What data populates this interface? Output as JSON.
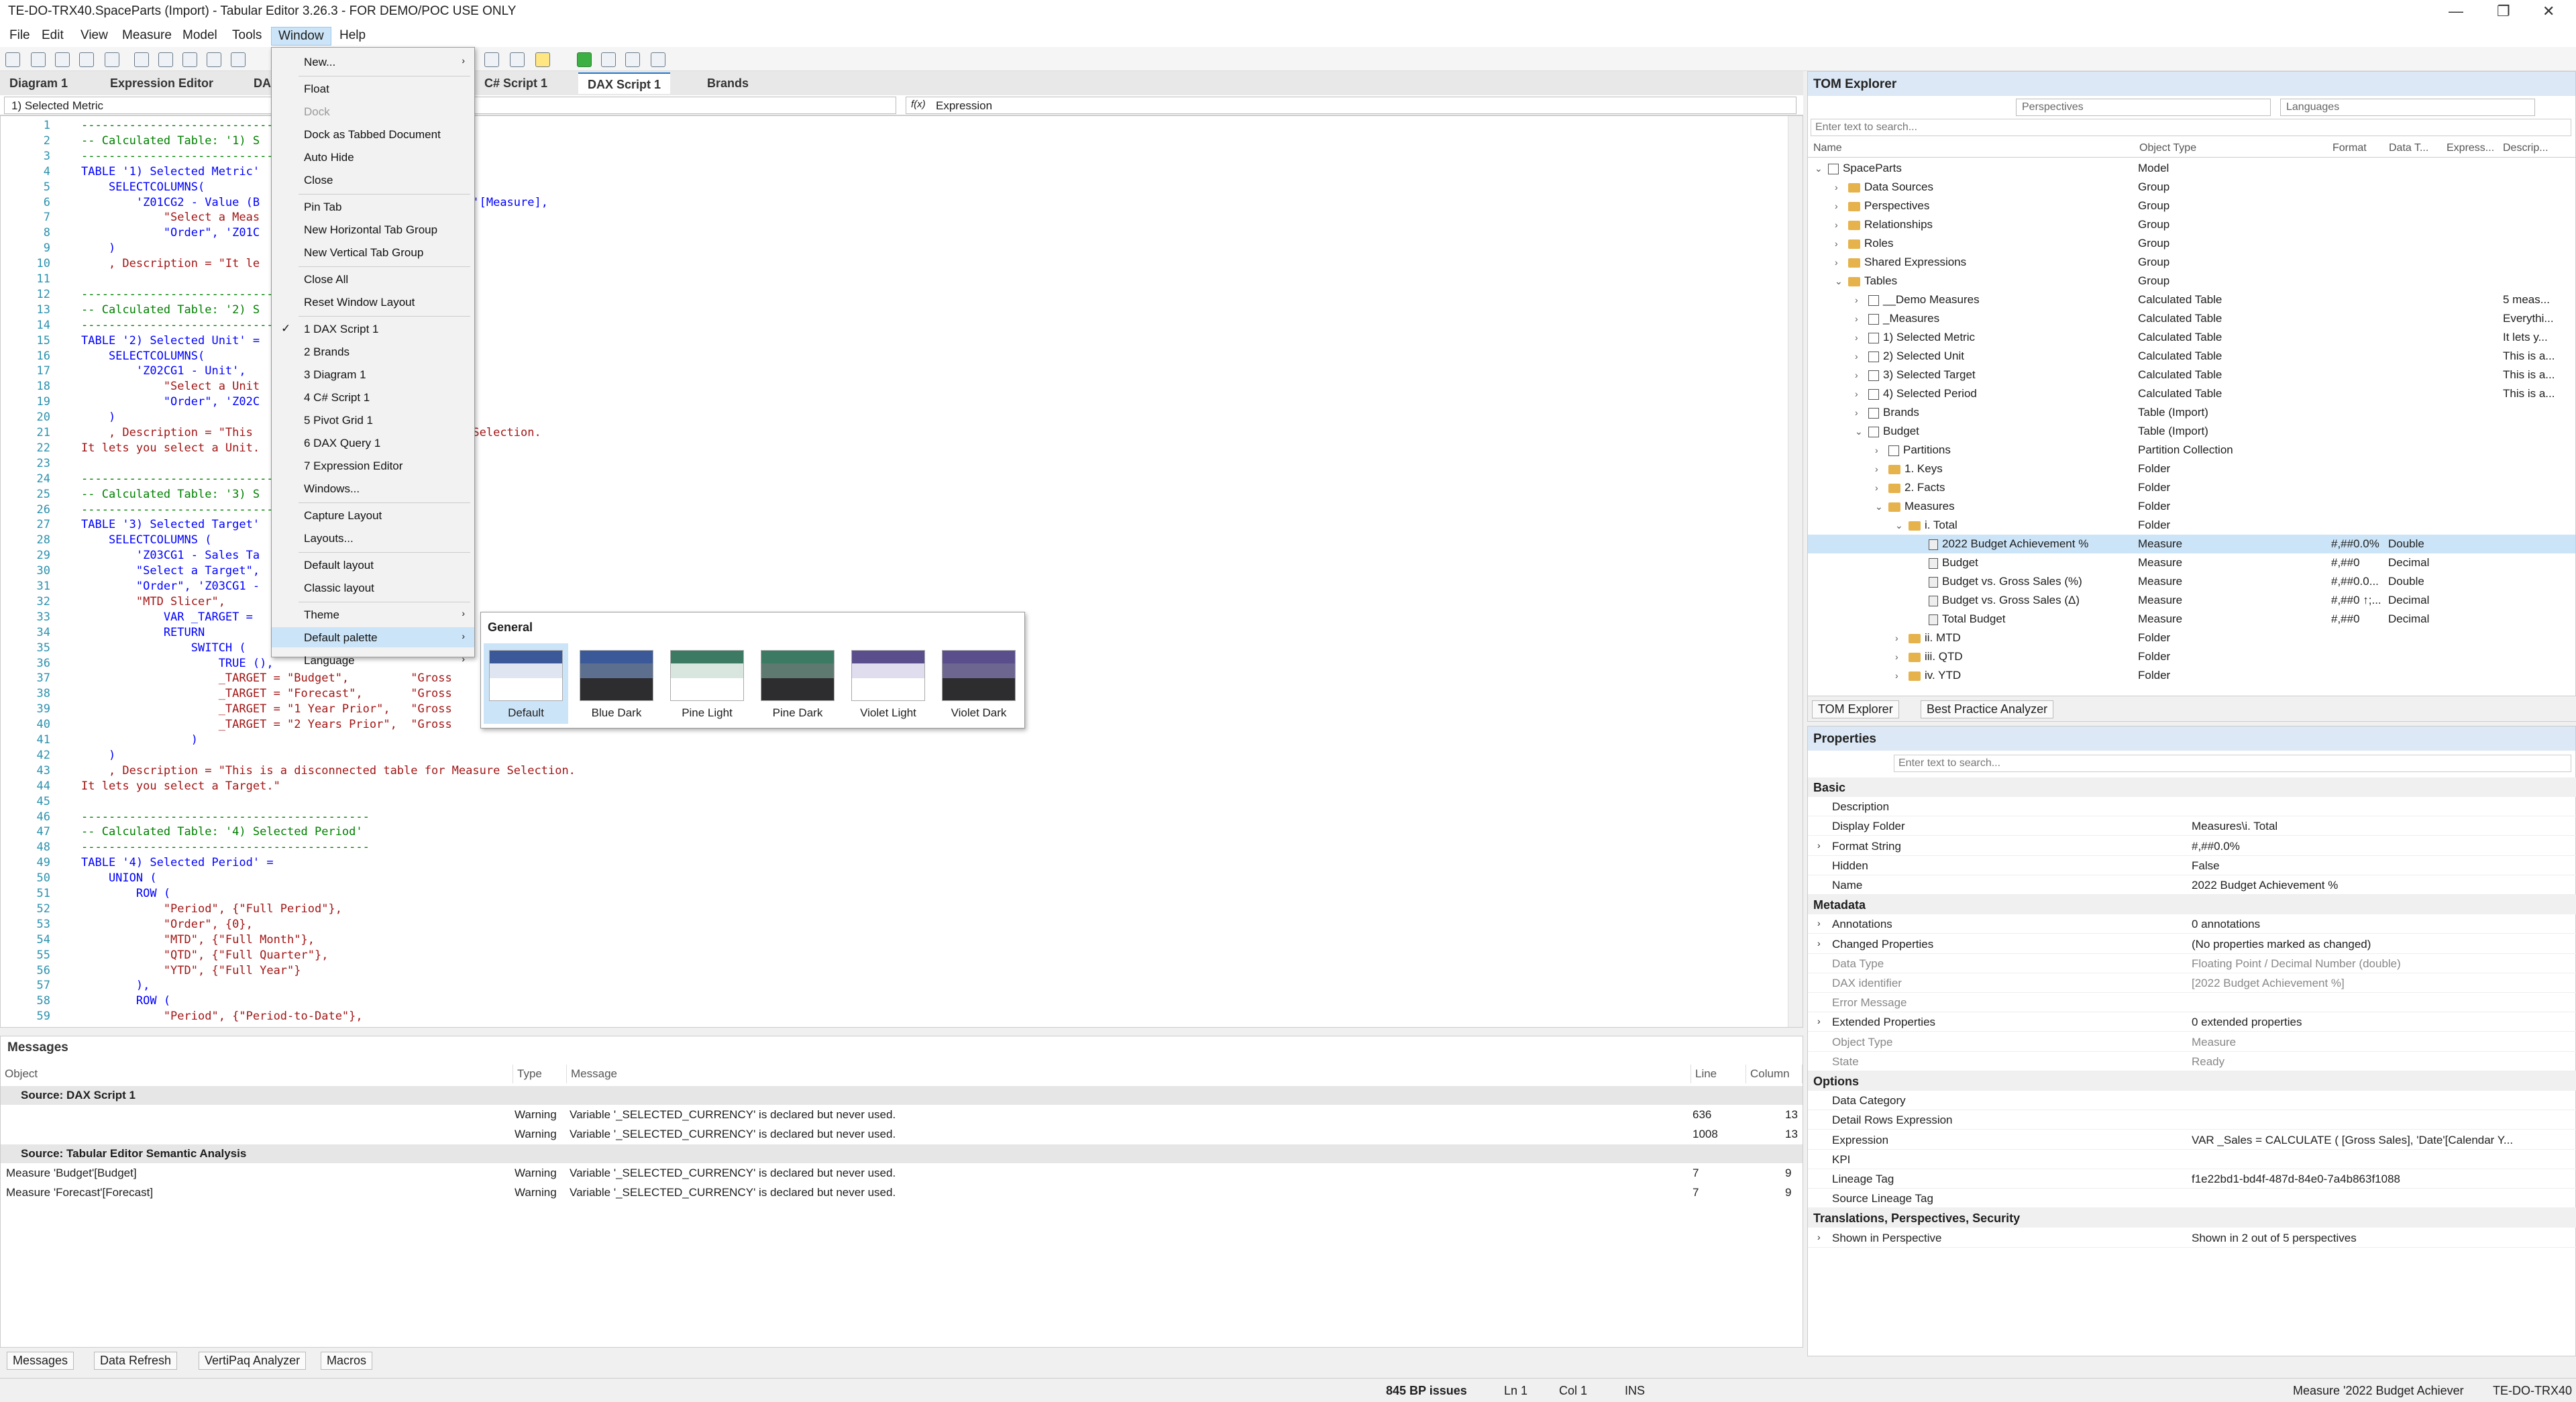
{
  "window": {
    "title": "TE-DO-TRX40.SpaceParts (Import) - Tabular Editor 3.26.3 - FOR DEMO/POC USE ONLY",
    "min": "—",
    "max": "❐",
    "close": "✕"
  },
  "menubar": [
    "File",
    "Edit",
    "View",
    "Measure",
    "Model",
    "Tools",
    "Window",
    "Help"
  ],
  "tabs": [
    "Diagram 1",
    "Expression Editor",
    "DA",
    "C# Script 1",
    "DAX Script 1",
    "Brands"
  ],
  "dropdowns": {
    "left": "1) Selected Metric",
    "right": "Expression",
    "fx": "f(x)"
  },
  "editor": {
    "lines": [
      "1",
      "2",
      "3",
      "4",
      "5",
      "6",
      "7",
      "8",
      "9",
      "10",
      "11",
      "12",
      "13",
      "14",
      "15",
      "16",
      "17",
      "18",
      "19",
      "20",
      "21",
      "22",
      "23",
      "24",
      "25",
      "26",
      "27",
      "28",
      "29",
      "30",
      "31",
      "32",
      "33",
      "34",
      "35",
      "36",
      "37",
      "38",
      "39",
      "40",
      "41",
      "42",
      "43",
      "44",
      "45",
      "46",
      "47",
      "48",
      "49",
      "50",
      "51",
      "52",
      "53",
      "54",
      "55",
      "56",
      "57",
      "58",
      "59"
    ],
    "code": [
      {
        "t": "------------------------------------------",
        "c": "c"
      },
      {
        "t": "-- Calculated Table: '1) S",
        "c": "c"
      },
      {
        "t": "------------------------------------------",
        "c": "c"
      },
      {
        "t": "TABLE '1) Selected Metric'",
        "c": "k"
      },
      {
        "t": "    SELECTCOLUMNS(",
        "c": "k"
      },
      {
        "t": "        'Z01CG2 - Value (B                        t Rate)'[Measure],",
        "c": "k"
      },
      {
        "t": "            \"Select a Meas",
        "c": "s"
      },
      {
        "t": "            \"Order\", 'Z01C                       rdinal]",
        "c": "k"
      },
      {
        "t": "    )",
        "c": "k"
      },
      {
        "t": "    , Description = \"It le",
        "c": "s"
      },
      {
        "t": "",
        "c": "k"
      },
      {
        "t": "------------------------------------------",
        "c": "c"
      },
      {
        "t": "-- Calculated Table: '2) S",
        "c": "c"
      },
      {
        "t": "------------------------------------------",
        "c": "c"
      },
      {
        "t": "TABLE '2) Selected Unit' =",
        "c": "k"
      },
      {
        "t": "    SELECTCOLUMNS(",
        "c": "k"
      },
      {
        "t": "        'Z02CG1 - Unit',",
        "c": "k"
      },
      {
        "t": "            \"Select a Unit",
        "c": "s"
      },
      {
        "t": "            \"Order\", 'Z02C",
        "c": "k"
      },
      {
        "t": "    )",
        "c": "k"
      },
      {
        "t": "    , Description = \"This                        Measure Selection.",
        "c": "s"
      },
      {
        "t": "It lets you select a Unit.",
        "c": "s"
      },
      {
        "t": "",
        "c": "k"
      },
      {
        "t": "------------------------------------------",
        "c": "c"
      },
      {
        "t": "-- Calculated Table: '3) S",
        "c": "c"
      },
      {
        "t": "------------------------------------------",
        "c": "c"
      },
      {
        "t": "TABLE '3) Selected Target'",
        "c": "k"
      },
      {
        "t": "    SELECTCOLUMNS (",
        "c": "k"
      },
      {
        "t": "        'Z03CG1 - Sales Ta",
        "c": "k"
      },
      {
        "t": "        \"Select a Target\",                        rget],",
        "c": "k"
      },
      {
        "t": "        \"Order\", 'Z03CG1 -",
        "c": "k"
      },
      {
        "t": "        \"MTD Slicer\",",
        "c": "s"
      },
      {
        "t": "            VAR _TARGET =",
        "c": "k"
      },
      {
        "t": "            RETURN",
        "c": "k"
      },
      {
        "t": "                SWITCH (",
        "c": "k"
      },
      {
        "t": "                    TRUE (),",
        "c": "k"
      },
      {
        "t": "                    _TARGET = \"Budget\",         \"Gross",
        "c": "s"
      },
      {
        "t": "                    _TARGET = \"Forecast\",       \"Gross",
        "c": "s"
      },
      {
        "t": "                    _TARGET = \"1 Year Prior\",   \"Gross",
        "c": "s"
      },
      {
        "t": "                    _TARGET = \"2 Years Prior\",  \"Gross",
        "c": "s"
      },
      {
        "t": "                )",
        "c": "k"
      },
      {
        "t": "    )",
        "c": "k"
      },
      {
        "t": "    , Description = \"This is a disconnected table for Measure Selection.",
        "c": "s"
      },
      {
        "t": "It lets you select a Target.\"",
        "c": "s"
      },
      {
        "t": "",
        "c": "k"
      },
      {
        "t": "------------------------------------------",
        "c": "c"
      },
      {
        "t": "-- Calculated Table: '4) Selected Period'",
        "c": "c"
      },
      {
        "t": "------------------------------------------",
        "c": "c"
      },
      {
        "t": "TABLE '4) Selected Period' =",
        "c": "k"
      },
      {
        "t": "    UNION (",
        "c": "k"
      },
      {
        "t": "        ROW (",
        "c": "k"
      },
      {
        "t": "            \"Period\", {\"Full Period\"},",
        "c": "s"
      },
      {
        "t": "            \"Order\", {0},",
        "c": "s"
      },
      {
        "t": "            \"MTD\", {\"Full Month\"},",
        "c": "s"
      },
      {
        "t": "            \"QTD\", {\"Full Quarter\"},",
        "c": "s"
      },
      {
        "t": "            \"YTD\", {\"Full Year\"}",
        "c": "s"
      },
      {
        "t": "        ),",
        "c": "k"
      },
      {
        "t": "        ROW (",
        "c": "k"
      },
      {
        "t": "            \"Period\", {\"Period-to-Date\"},",
        "c": "s"
      }
    ]
  },
  "window_menu": {
    "items": [
      {
        "label": "New...",
        "sub": "›"
      },
      {
        "label": "Float"
      },
      {
        "label": "Dock",
        "disabled": true
      },
      {
        "label": "Dock as Tabbed Document"
      },
      {
        "label": "Auto Hide"
      },
      {
        "label": "Close"
      },
      {
        "label": "Pin Tab"
      },
      {
        "label": "New Horizontal Tab Group"
      },
      {
        "label": "New Vertical Tab Group"
      },
      {
        "label": "Close All"
      },
      {
        "label": "Reset Window Layout"
      },
      {
        "label": "1 DAX Script 1",
        "check": "✓"
      },
      {
        "label": "2 Brands"
      },
      {
        "label": "3 Diagram 1"
      },
      {
        "label": "4 C# Script 1"
      },
      {
        "label": "5 Pivot Grid 1"
      },
      {
        "label": "6 DAX Query 1"
      },
      {
        "label": "7 Expression Editor"
      },
      {
        "label": "Windows..."
      },
      {
        "label": "Capture Layout"
      },
      {
        "label": "Layouts..."
      },
      {
        "label": "Default layout"
      },
      {
        "label": "Classic layout"
      },
      {
        "label": "Theme",
        "sub": "›"
      },
      {
        "label": "Default palette",
        "sub": "›"
      },
      {
        "label": "Language",
        "sub": "›"
      }
    ]
  },
  "palette": {
    "group": "General",
    "items": [
      {
        "name": "Default",
        "c1": "#3b5998",
        "c2": "#dfe6f2",
        "c3": "#ffffff"
      },
      {
        "name": "Blue Dark",
        "c1": "#3b5998",
        "c2": "#5d6f8e",
        "c3": "#2d2d30"
      },
      {
        "name": "Pine Light",
        "c1": "#3c7a64",
        "c2": "#d8e6df",
        "c3": "#ffffff"
      },
      {
        "name": "Pine Dark",
        "c1": "#3c7a64",
        "c2": "#5e7a70",
        "c3": "#2d2d30"
      },
      {
        "name": "Violet Light",
        "c1": "#5a4f8c",
        "c2": "#e0ddef",
        "c3": "#ffffff"
      },
      {
        "name": "Violet Dark",
        "c1": "#5a4f8c",
        "c2": "#6d6690",
        "c3": "#2d2d30"
      }
    ]
  },
  "messages": {
    "title": "Messages",
    "columns": [
      "Object",
      "Type",
      "Message",
      "Line",
      "Column"
    ],
    "rows": [
      {
        "group": "Source: DAX Script 1"
      },
      {
        "object": "",
        "type": "Warning",
        "message": "Variable '_SELECTED_CURRENCY' is declared but never used.",
        "line": "636",
        "col": "13"
      },
      {
        "object": "",
        "type": "Warning",
        "message": "Variable '_SELECTED_CURRENCY' is declared but never used.",
        "line": "1008",
        "col": "13"
      },
      {
        "group": "Source: Tabular Editor Semantic Analysis"
      },
      {
        "object": "Measure 'Budget'[Budget]",
        "type": "Warning",
        "message": "Variable '_SELECTED_CURRENCY' is declared but never used.",
        "line": "7",
        "col": "9"
      },
      {
        "object": "Measure 'Forecast'[Forecast]",
        "type": "Warning",
        "message": "Variable '_SELECTED_CURRENCY' is declared but never used.",
        "line": "7",
        "col": "9"
      }
    ]
  },
  "bottom_tabs": [
    "Messages",
    "Data Refresh",
    "VertiPaq Analyzer",
    "Macros"
  ],
  "status": {
    "bp": "845 BP issues",
    "ln": "Ln 1",
    "col": "Col 1",
    "ins": "INS",
    "obj": "Measure '2022 Budget Achiever",
    "server": "TE-DO-TRX40"
  },
  "tom": {
    "title": "TOM Explorer",
    "perspectives": "Perspectives",
    "languages": "Languages",
    "filter": "Enter text to search...",
    "columns": [
      "Name",
      "Object Type",
      "Format",
      "Data T...",
      "Express...",
      "Descrip..."
    ],
    "nodes": [
      {
        "d": 0,
        "a": "⌄",
        "i": "tbl",
        "n": "SpaceParts",
        "t": "Model"
      },
      {
        "d": 1,
        "a": "›",
        "i": "fld",
        "n": "Data Sources",
        "t": "Group"
      },
      {
        "d": 1,
        "a": "›",
        "i": "fld",
        "n": "Perspectives",
        "t": "Group"
      },
      {
        "d": 1,
        "a": "›",
        "i": "fld",
        "n": "Relationships",
        "t": "Group"
      },
      {
        "d": 1,
        "a": "›",
        "i": "fld",
        "n": "Roles",
        "t": "Group"
      },
      {
        "d": 1,
        "a": "›",
        "i": "fld",
        "n": "Shared Expressions",
        "t": "Group"
      },
      {
        "d": 1,
        "a": "⌄",
        "i": "fld",
        "n": "Tables",
        "t": "Group"
      },
      {
        "d": 2,
        "a": "›",
        "i": "tbl",
        "n": "__Demo Measures",
        "t": "Calculated Table",
        "de": "5 meas..."
      },
      {
        "d": 2,
        "a": "›",
        "i": "tbl",
        "n": "_Measures",
        "t": "Calculated Table",
        "de": "Everythi..."
      },
      {
        "d": 2,
        "a": "›",
        "i": "tbl",
        "n": "1) Selected Metric",
        "t": "Calculated Table",
        "de": "It lets y..."
      },
      {
        "d": 2,
        "a": "›",
        "i": "tbl",
        "n": "2) Selected Unit",
        "t": "Calculated Table",
        "de": "This is a..."
      },
      {
        "d": 2,
        "a": "›",
        "i": "tbl",
        "n": "3) Selected Target",
        "t": "Calculated Table",
        "de": "This is a..."
      },
      {
        "d": 2,
        "a": "›",
        "i": "tbl",
        "n": "4) Selected Period",
        "t": "Calculated Table",
        "de": "This is a..."
      },
      {
        "d": 2,
        "a": "›",
        "i": "tbl",
        "n": "Brands",
        "t": "Table (Import)"
      },
      {
        "d": 2,
        "a": "⌄",
        "i": "tbl",
        "n": "Budget",
        "t": "Table (Import)"
      },
      {
        "d": 3,
        "a": "›",
        "i": "tbl",
        "n": "Partitions",
        "t": "Partition Collection"
      },
      {
        "d": 3,
        "a": "›",
        "i": "fld",
        "n": "1. Keys",
        "t": "Folder"
      },
      {
        "d": 3,
        "a": "›",
        "i": "fld",
        "n": "2. Facts",
        "t": "Folder"
      },
      {
        "d": 3,
        "a": "⌄",
        "i": "fld",
        "n": "Measures",
        "t": "Folder"
      },
      {
        "d": 4,
        "a": "⌄",
        "i": "fld",
        "n": "i. Total",
        "t": "Folder"
      },
      {
        "d": 5,
        "a": "",
        "i": "msr",
        "n": "2022 Budget Achievement %",
        "t": "Measure",
        "f": "#,##0.0%",
        "dt": "Double",
        "sel": true
      },
      {
        "d": 5,
        "a": "",
        "i": "msr",
        "n": "Budget",
        "t": "Measure",
        "f": "#,##0",
        "dt": "Decimal"
      },
      {
        "d": 5,
        "a": "",
        "i": "msr",
        "n": "Budget vs. Gross Sales (%)",
        "t": "Measure",
        "f": "#,##0.0...",
        "dt": "Double"
      },
      {
        "d": 5,
        "a": "",
        "i": "msr",
        "n": "Budget vs. Gross Sales (Δ)",
        "t": "Measure",
        "f": "#,##0 ↑;...",
        "dt": "Decimal"
      },
      {
        "d": 5,
        "a": "",
        "i": "msr",
        "n": "Total Budget",
        "t": "Measure",
        "f": "#,##0",
        "dt": "Decimal"
      },
      {
        "d": 4,
        "a": "›",
        "i": "fld",
        "n": "ii. MTD",
        "t": "Folder"
      },
      {
        "d": 4,
        "a": "›",
        "i": "fld",
        "n": "iii. QTD",
        "t": "Folder"
      },
      {
        "d": 4,
        "a": "›",
        "i": "fld",
        "n": "iv. YTD",
        "t": "Folder"
      }
    ],
    "tabs": [
      "TOM Explorer",
      "Best Practice Analyzer"
    ]
  },
  "props": {
    "title": "Properties",
    "filter": "Enter text to search...",
    "rows": [
      {
        "cat": "Basic"
      },
      {
        "k": "Description",
        "v": ""
      },
      {
        "k": "Display Folder",
        "v": "Measures\\i. Total"
      },
      {
        "k": "Format String",
        "v": "#,##0.0%",
        "exp": true
      },
      {
        "k": "Hidden",
        "v": "False"
      },
      {
        "k": "Name",
        "v": "2022 Budget Achievement %"
      },
      {
        "cat": "Metadata"
      },
      {
        "k": "Annotations",
        "v": "0 annotations",
        "exp": true
      },
      {
        "k": "Changed Properties",
        "v": "(No properties marked as changed)",
        "exp": true
      },
      {
        "k": "Data Type",
        "v": "Floating Point / Decimal Number (double)",
        "ro": true
      },
      {
        "k": "DAX identifier",
        "v": "[2022 Budget Achievement %]",
        "ro": true
      },
      {
        "k": "Error Message",
        "v": "",
        "ro": true
      },
      {
        "k": "Extended Properties",
        "v": "0 extended properties",
        "exp": true
      },
      {
        "k": "Object Type",
        "v": "Measure",
        "ro": true
      },
      {
        "k": "State",
        "v": "Ready",
        "ro": true
      },
      {
        "cat": "Options"
      },
      {
        "k": "Data Category",
        "v": ""
      },
      {
        "k": "Detail Rows Expression",
        "v": ""
      },
      {
        "k": "Expression",
        "v": "VAR _Sales =    CALCULATE (       [Gross Sales],       'Date'[Calendar Y..."
      },
      {
        "k": "KPI",
        "v": ""
      },
      {
        "k": "Lineage Tag",
        "v": "f1e22bd1-bd4f-487d-84e0-7a4b863f1088"
      },
      {
        "k": "Source Lineage Tag",
        "v": ""
      },
      {
        "cat": "Translations, Perspectives, Security"
      },
      {
        "k": "Shown in Perspective",
        "v": "Shown in 2 out of 5 perspectives",
        "exp": true
      }
    ]
  }
}
